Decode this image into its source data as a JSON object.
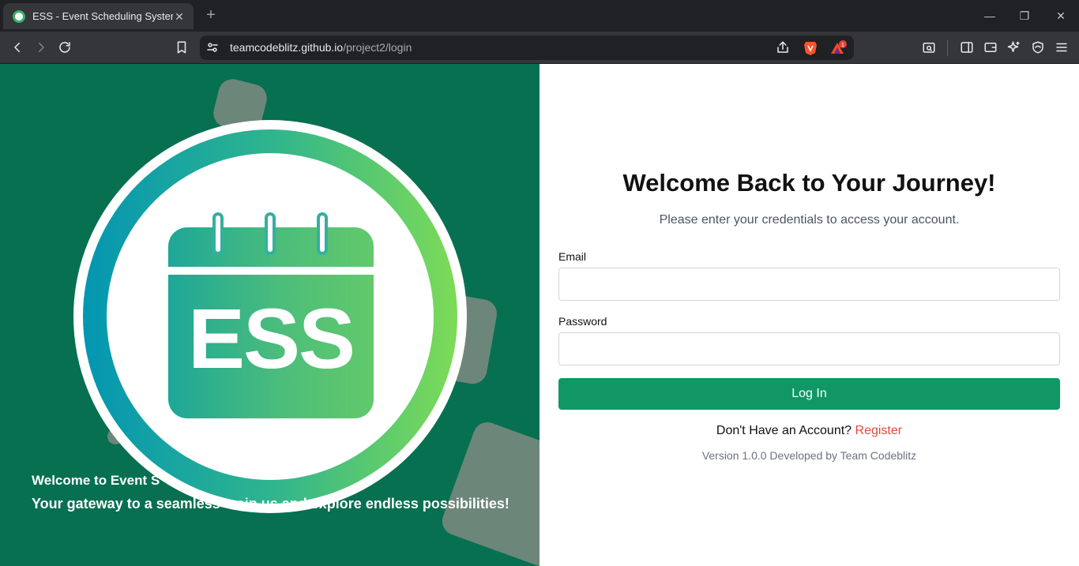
{
  "browser": {
    "tab": {
      "title": "ESS - Event Scheduling System",
      "close": "✕"
    },
    "new_tab": "+",
    "window": {
      "minimize": "—",
      "restore": "❐",
      "close": "✕"
    },
    "address": {
      "host": "teamcodeblitz.github.io",
      "path": "/project2/login"
    },
    "brave_rewards_badge": "1"
  },
  "hero": {
    "logo_text": "ESS",
    "welcome_title": "Welcome to Event S",
    "welcome_subtitle": "Your gateway to a seamless e            oin us and explore endless possibilities!"
  },
  "login": {
    "title": "Welcome Back to Your Journey!",
    "subtitle": "Please enter your credentials to access your account.",
    "email_label": "Email",
    "password_label": "Password",
    "email_value": "",
    "password_value": "",
    "submit_label": "Log In",
    "no_account_text": "Don't Have an Account?",
    "register_link": "Register",
    "version_text": "Version 1.0.0 Developed by Team Codeblitz"
  },
  "colors": {
    "panel_green": "#067050",
    "button_green": "#109765",
    "register_red": "#e2483d",
    "ring_gradient": [
      "#0396b2",
      "#2fb48e",
      "#7ddb57"
    ]
  }
}
